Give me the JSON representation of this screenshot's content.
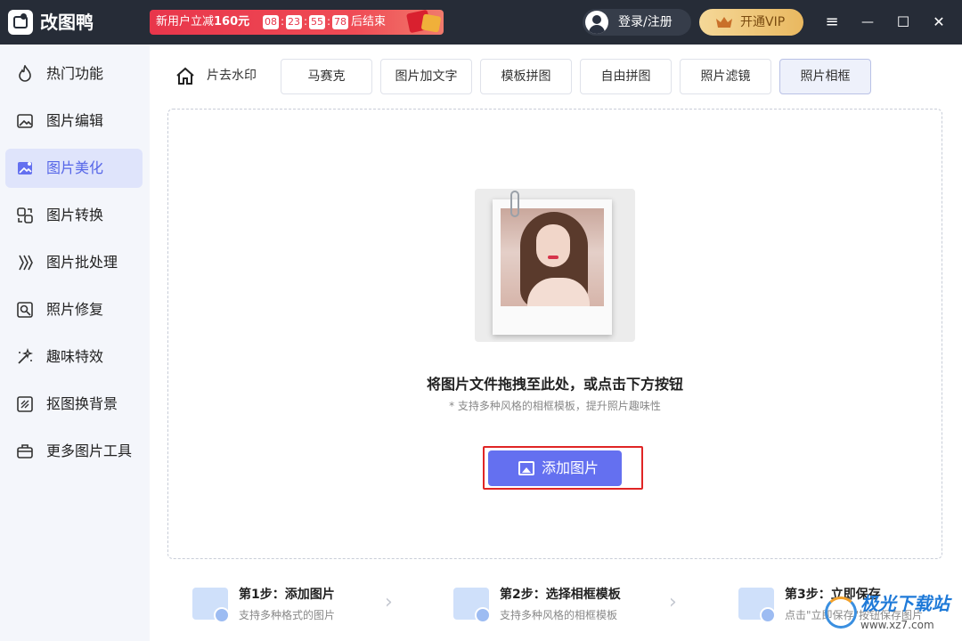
{
  "app": {
    "name": "改图鸭"
  },
  "promo": {
    "text_prefix": "新用户立减",
    "text_amount": "160元",
    "timer": [
      "08",
      "23",
      "55",
      "78"
    ],
    "suffix": "后结束"
  },
  "header": {
    "login_label": "登录/注册",
    "vip_label": "开通VIP",
    "menu_icon": "≡",
    "minimize_icon": "—",
    "maximize_icon": "☐",
    "close_icon": "✕"
  },
  "sidebar": {
    "items": [
      {
        "label": "热门功能",
        "icon": "flame-icon"
      },
      {
        "label": "图片编辑",
        "icon": "image-edit-icon"
      },
      {
        "label": "图片美化",
        "icon": "image-beautify-icon",
        "active": true
      },
      {
        "label": "图片转换",
        "icon": "convert-icon"
      },
      {
        "label": "图片批处理",
        "icon": "batch-icon"
      },
      {
        "label": "照片修复",
        "icon": "repair-icon"
      },
      {
        "label": "趣味特效",
        "icon": "magic-wand-icon"
      },
      {
        "label": "抠图换背景",
        "icon": "cutout-icon"
      },
      {
        "label": "更多图片工具",
        "icon": "toolbox-icon"
      }
    ]
  },
  "tabs": {
    "items": [
      {
        "label": "片去水印"
      },
      {
        "label": "马赛克"
      },
      {
        "label": "图片加文字"
      },
      {
        "label": "模板拼图"
      },
      {
        "label": "自由拼图"
      },
      {
        "label": "照片滤镜"
      },
      {
        "label": "照片相框",
        "active": true
      }
    ]
  },
  "dropzone": {
    "title": "将图片文件拖拽至此处，或点击下方按钮",
    "subtitle": "* 支持多种风格的相框模板，提升照片趣味性",
    "button_label": "添加图片"
  },
  "steps": [
    {
      "title": "第1步：添加图片",
      "desc": "支持多种格式的图片"
    },
    {
      "title": "第2步：选择相框模板",
      "desc": "支持多种风格的相框模板"
    },
    {
      "title": "第3步：立即保存",
      "desc": "点击\"立即保存\"按钮保存图片"
    }
  ],
  "watermark": {
    "text": "极光下载站",
    "sub": "www.xz7.com"
  },
  "colors": {
    "accent": "#6470f0",
    "titlebar": "#262c37",
    "active_side": "#dfe4fb",
    "highlight_frame": "#e02525"
  }
}
